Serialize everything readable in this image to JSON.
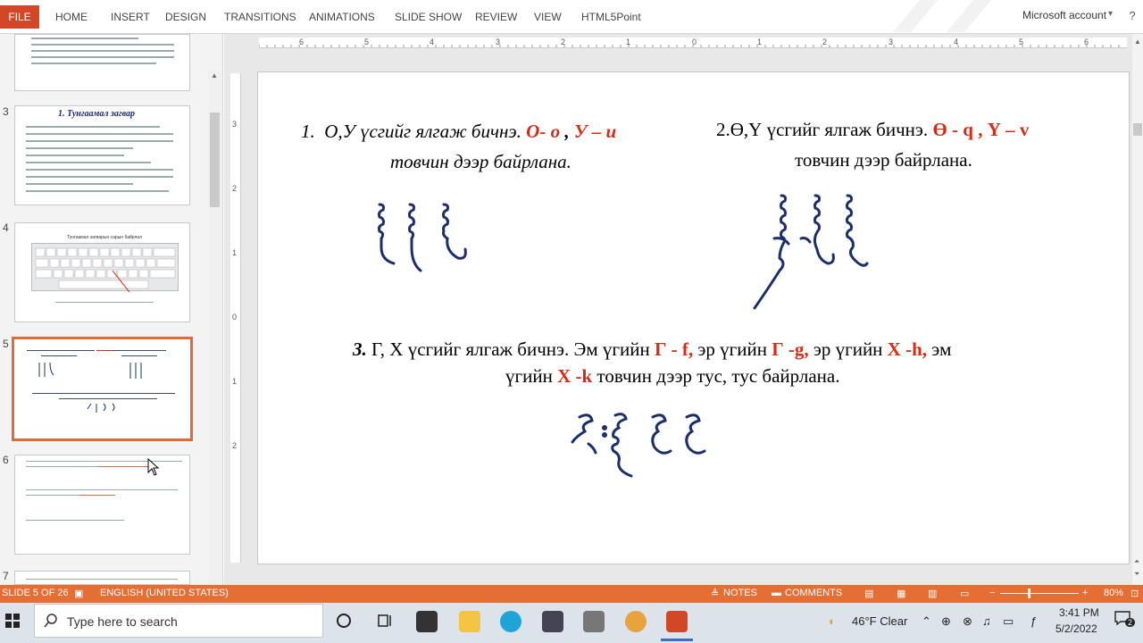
{
  "ribbon": {
    "file": "FILE",
    "tabs": [
      "HOME",
      "INSERT",
      "DESIGN",
      "TRANSITIONS",
      "ANIMATIONS",
      "SLIDE SHOW",
      "REVIEW",
      "VIEW",
      "HTML5Point"
    ],
    "account": "Microsoft account",
    "help": "?",
    "minimize": "—",
    "maximize": "□",
    "close": "✕"
  },
  "thumbnails": {
    "numbers": [
      "3",
      "4",
      "5",
      "6",
      "7"
    ],
    "slide3_title": "1. Тунгаамал загвар",
    "slide4_title": "Тунгаамал загварын сарын байрлал",
    "slide5_item": "5"
  },
  "ruler": {
    "h_ticks": [
      "6",
      "5",
      "4",
      "3",
      "2",
      "1",
      "0",
      "1",
      "2",
      "3",
      "4",
      "5",
      "6"
    ],
    "v_ticks": [
      "3",
      "2",
      "1",
      "0",
      "1",
      "2"
    ]
  },
  "slide": {
    "p1_num": "1.",
    "p1_a": "О,У үсгийг ялгаж бичнэ.",
    "p1_red1": "О- о",
    "p1_comma": ",",
    "p1_red2": "У – и",
    "p1_b": "товчин дээр байрлана.",
    "p2_a": "2.Ө,Ү үсгийг ялгаж бичнэ.",
    "p2_red1": "Ө - q",
    "p2_comma": ",",
    "p2_red2": "Ү – v",
    "p2_b": "товчин дээр байрлана.",
    "p3_num": "3.",
    "p3_a": "Г, Х үсгийг ялгаж бичнэ. Эм үгийн",
    "p3_red1": "Г - f,",
    "p3_b": "эр үгийн",
    "p3_red2": "Г -g,",
    "p3_c": "эр үгийн",
    "p3_red3": "Х -h,",
    "p3_d": "эм",
    "p3_e": "үгийн",
    "p3_red4": "Х -k",
    "p3_f": "товчин дээр тус, тус байрлана."
  },
  "statusbar": {
    "slide": "SLIDE 5 OF 26",
    "language": "ENGLISH (UNITED STATES)",
    "notes": "NOTES",
    "comments": "COMMENTS",
    "zoom": "80%"
  },
  "taskbar": {
    "search_placeholder": "Type here to search",
    "weather": "46°F  Clear",
    "time": "3:41 PM",
    "date": "5/2/2022",
    "notif": "2"
  },
  "colors": {
    "accent": "#e56e35",
    "file_tab": "#d24726",
    "red_text": "#d42d17",
    "script": "#1c2f6b"
  }
}
